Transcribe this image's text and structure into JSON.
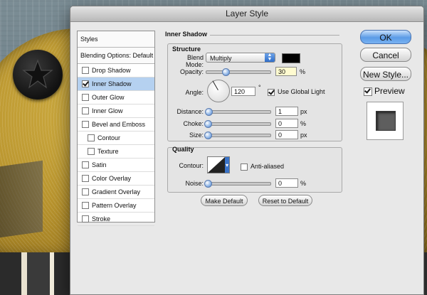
{
  "dialog": {
    "title": "Layer Style"
  },
  "styles_list": {
    "header": "Styles",
    "blending_options": "Blending Options: Default",
    "items": [
      {
        "label": "Drop Shadow",
        "checked": false,
        "active": false,
        "sub": false
      },
      {
        "label": "Inner Shadow",
        "checked": true,
        "active": true,
        "sub": false
      },
      {
        "label": "Outer Glow",
        "checked": false,
        "active": false,
        "sub": false
      },
      {
        "label": "Inner Glow",
        "checked": false,
        "active": false,
        "sub": false
      },
      {
        "label": "Bevel and Emboss",
        "checked": false,
        "active": false,
        "sub": false
      },
      {
        "label": "Contour",
        "checked": false,
        "active": false,
        "sub": true
      },
      {
        "label": "Texture",
        "checked": false,
        "active": false,
        "sub": true
      },
      {
        "label": "Satin",
        "checked": false,
        "active": false,
        "sub": false
      },
      {
        "label": "Color Overlay",
        "checked": false,
        "active": false,
        "sub": false
      },
      {
        "label": "Gradient Overlay",
        "checked": false,
        "active": false,
        "sub": false
      },
      {
        "label": "Pattern Overlay",
        "checked": false,
        "active": false,
        "sub": false
      },
      {
        "label": "Stroke",
        "checked": false,
        "active": false,
        "sub": false
      }
    ]
  },
  "inner_shadow": {
    "section_title": "Inner Shadow",
    "structure": {
      "title": "Structure",
      "blend_mode_label": "Blend Mode:",
      "blend_mode_value": "Multiply",
      "shadow_color": "#000000",
      "opacity_label": "Opacity:",
      "opacity_value": "30",
      "opacity_unit": "%",
      "angle_label": "Angle:",
      "angle_value": "120",
      "angle_unit": "°",
      "use_global_light_label": "Use Global Light",
      "use_global_light": true,
      "distance_label": "Distance:",
      "distance_value": "1",
      "distance_unit": "px",
      "choke_label": "Choke:",
      "choke_value": "0",
      "choke_unit": "%",
      "size_label": "Size:",
      "size_value": "0",
      "size_unit": "px"
    },
    "quality": {
      "title": "Quality",
      "contour_label": "Contour:",
      "anti_aliased_label": "Anti-aliased",
      "anti_aliased": false,
      "noise_label": "Noise:",
      "noise_value": "0",
      "noise_unit": "%"
    },
    "make_default_label": "Make Default",
    "reset_default_label": "Reset to Default"
  },
  "actions": {
    "ok_label": "OK",
    "cancel_label": "Cancel",
    "new_style_label": "New Style...",
    "preview_label": "Preview",
    "preview_checked": true
  }
}
